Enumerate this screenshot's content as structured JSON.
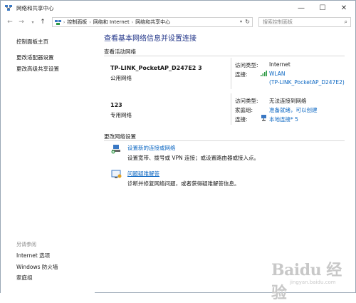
{
  "window": {
    "title": "网络和共享中心"
  },
  "address": {
    "crumbs": [
      "控制面板",
      "网络和 Internet",
      "网络和共享中心"
    ],
    "search_placeholder": "搜索控制面板"
  },
  "sidebar": {
    "links": [
      "控制面板主页",
      "更改适配器设置",
      "更改高级共享设置"
    ],
    "see_also_head": "另请参阅",
    "see_also": [
      "Internet 选项",
      "Windows 防火墙",
      "家庭组"
    ]
  },
  "main": {
    "title": "查看基本网络信息并设置连接",
    "active_head": "查看活动网络",
    "networks": [
      {
        "name": "TP-LINK_PocketAP_D247E2  3",
        "type": "公用网络",
        "access_label": "访问类型:",
        "access_value": "Internet",
        "conn_label": "连接:",
        "conn_value": "WLAN",
        "conn_value2": "(TP-LINK_PocketAP_D247E2)"
      },
      {
        "name": "123",
        "type": "专用网络",
        "access_label": "访问类型:",
        "access_value": "无法连接到网络",
        "home_label": "家庭组:",
        "home_value": "准备就绪，可以创建",
        "conn_label": "连接:",
        "conn_value": "本地连接* 5"
      }
    ],
    "change_head": "更改网络设置",
    "tasks": [
      {
        "link": "设置新的连接或网络",
        "desc": "设置宽带、拨号或 VPN 连接；或设置路由器或接入点。"
      },
      {
        "link": "问题疑难解答",
        "desc": "诊断并修复网络问题，或者获得疑难解答信息。"
      }
    ]
  },
  "watermark": {
    "text": "Baidu 经验",
    "sub": "jingyan.baidu.com"
  }
}
